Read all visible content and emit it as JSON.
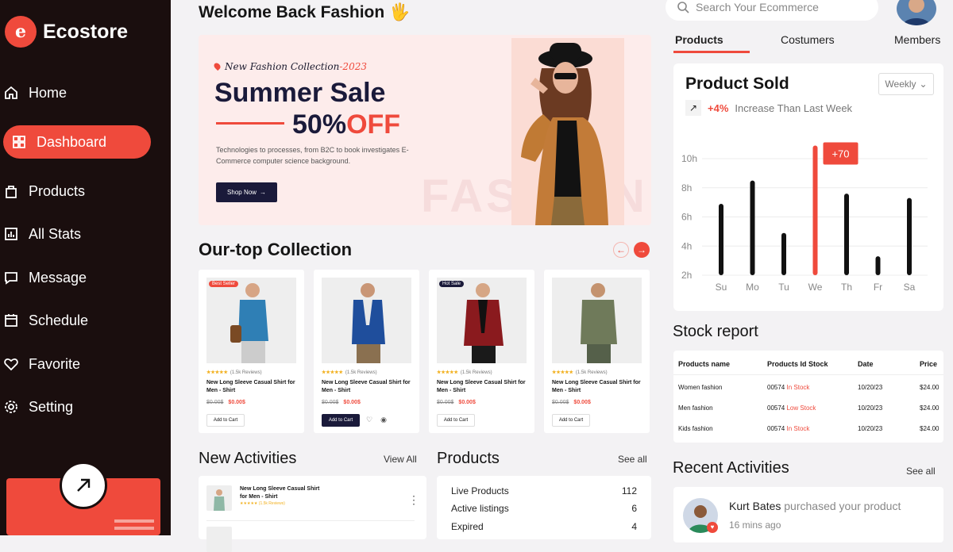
{
  "brand": {
    "name": "Ecostore",
    "logo_letter": "e"
  },
  "sidebar": {
    "items": [
      {
        "label": "Home",
        "icon": "home-icon"
      },
      {
        "label": "Dashboard",
        "icon": "grid-icon"
      },
      {
        "label": "Products",
        "icon": "bag-icon"
      },
      {
        "label": "All Stats",
        "icon": "stats-icon"
      },
      {
        "label": "Message",
        "icon": "message-icon"
      },
      {
        "label": "Schedule",
        "icon": "calendar-icon"
      },
      {
        "label": "Favorite",
        "icon": "heart-icon"
      },
      {
        "label": "Setting",
        "icon": "gear-icon"
      }
    ]
  },
  "header": {
    "welcome": "Welcome Back  Fashion",
    "wave": "🖐"
  },
  "hero": {
    "subtitle": "New Fashion Collection",
    "year": "-2023",
    "title": "Summer Sale",
    "percent": "50%",
    "off": "OFF",
    "description": "Technologies to processes, from B2C to book investigates E-Commerce computer science background.",
    "button": "Shop Now",
    "watermark": "FASHION"
  },
  "collection": {
    "title": "Our-top Collection",
    "cards": [
      {
        "badge": "Best Seller",
        "badge_color": "#ef4a3c",
        "stars": "★★★★★",
        "reviews": "(1.5k Reviews)",
        "name": "New Long Sleeve Casual Shirt for Men - Shirt",
        "old_price": "$0.00$",
        "price": "$0.00$",
        "cart": "Add to Cart"
      },
      {
        "badge": "",
        "badge_color": "",
        "stars": "★★★★★",
        "reviews": "(1.5k Reviews)",
        "name": "New Long Sleeve Casual Shirt for Men - Shirt",
        "old_price": "$0.00$",
        "price": "$0.00$",
        "cart": "Add to Cart"
      },
      {
        "badge": "Hot Sale",
        "badge_color": "#1a1a3a",
        "stars": "★★★★★",
        "reviews": "(1.5k Reviews)",
        "name": "New Long Sleeve Casual Shirt for Men - Shirt",
        "old_price": "$0.00$",
        "price": "$0.00$",
        "cart": "Add to Cart"
      },
      {
        "badge": "",
        "badge_color": "",
        "stars": "★★★★★",
        "reviews": "(1.5k Reviews)",
        "name": "New Long Sleeve Casual Shirt for Men - Shirt",
        "old_price": "$0.00$",
        "price": "$0.00$",
        "cart": "Add to Cart"
      }
    ]
  },
  "activities": {
    "title": "New Activities",
    "view_all": "View All",
    "item": {
      "name": "New Long Sleeve Casual Shirt for Men - Shirt",
      "stars": "★★★★★ (1.5k Reviews)"
    }
  },
  "products_panel": {
    "title": "Products",
    "see_all": "See all",
    "rows": [
      {
        "label": "Live Products",
        "value": "112"
      },
      {
        "label": "Active listings",
        "value": "6"
      },
      {
        "label": "Expired",
        "value": "4"
      }
    ]
  },
  "search": {
    "placeholder": "Search Your Ecommerce"
  },
  "right_tabs": [
    "Products",
    "Costumers",
    "Members"
  ],
  "product_sold": {
    "title": "Product Sold",
    "period": "Weekly",
    "increase": "+4%",
    "increase_text": "Increase Than Last Week",
    "highlight_label": "+70"
  },
  "chart_data": {
    "type": "bar",
    "categories": [
      "Su",
      "Mo",
      "Tu",
      "We",
      "Th",
      "Fr",
      "Sa"
    ],
    "values": [
      6.9,
      8.5,
      4.9,
      10.9,
      7.6,
      3.3,
      7.3
    ],
    "highlight_index": 3,
    "yticks": [
      "2h",
      "4h",
      "6h",
      "8h",
      "10h"
    ],
    "ylim": [
      2,
      10
    ],
    "bar_color": "#111111",
    "highlight_color": "#ef4a3c",
    "grid": true
  },
  "stock": {
    "title": "Stock report",
    "headers": [
      "Products name",
      "Products Id Stock",
      "Date",
      "Price"
    ],
    "rows": [
      {
        "name": "Women fashion",
        "id": "00574",
        "status": "In Stock",
        "date": "10/20/23",
        "price": "$24.00"
      },
      {
        "name": "Men fashion",
        "id": "00574",
        "status": "Low Stock",
        "date": "10/20/23",
        "price": "$24.00"
      },
      {
        "name": "Kids fashion",
        "id": "00574",
        "status": "In Stock",
        "date": "10/20/23",
        "price": "$24.00"
      }
    ]
  },
  "recent": {
    "title": "Recent Activities",
    "see_all": "See all",
    "user": "Kurt Bates",
    "action": "purchased your product",
    "time": "16 mins ago"
  },
  "colors": {
    "accent": "#ef4a3c",
    "sidebar": "#1a0e0e",
    "navy": "#1a1a3a"
  }
}
